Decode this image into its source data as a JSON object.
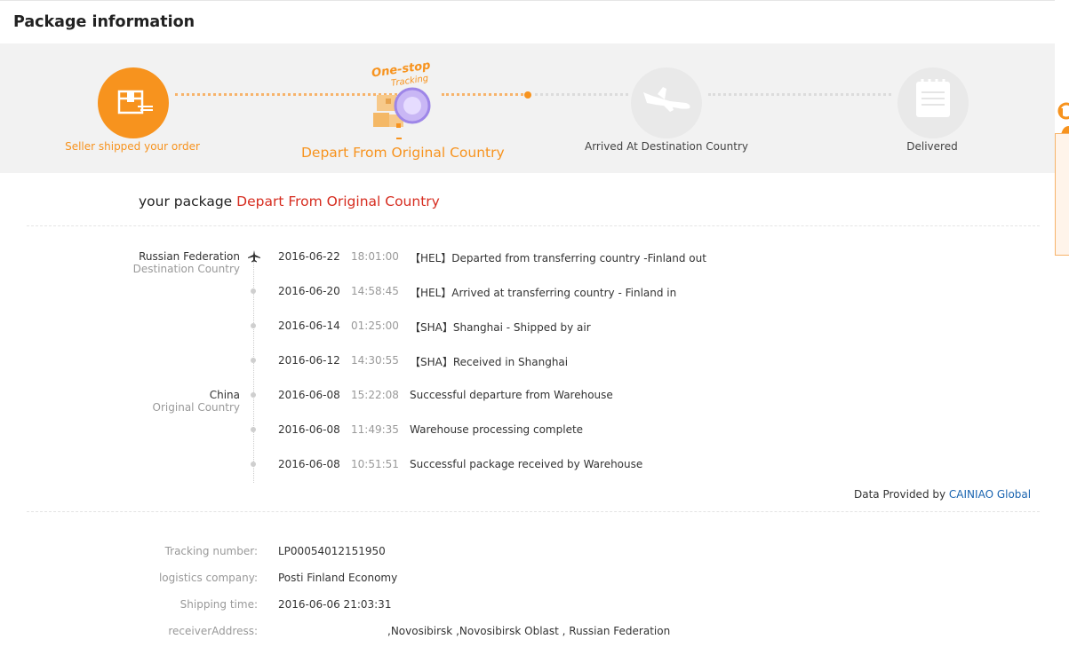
{
  "header": {
    "title": "Package information"
  },
  "steps": [
    {
      "label": "Seller shipped your order",
      "status": "done",
      "icon": "package-box-icon"
    },
    {
      "label": "Depart From Original Country",
      "status": "current",
      "icon": "one-stop-tracking-icon",
      "badge_line1": "One-stop",
      "badge_line2": "Tracking"
    },
    {
      "label": "Arrived At Destination Country",
      "status": "pending",
      "icon": "airplane-icon"
    },
    {
      "label": "Delivered",
      "status": "pending",
      "icon": "notepad-icon"
    }
  ],
  "summary": {
    "prefix": "your package",
    "status": "Depart From Original Country"
  },
  "locations": {
    "destination": {
      "name": "Russian Federation",
      "label": "Destination Country"
    },
    "origin": {
      "name": "China",
      "label": "Original Country"
    }
  },
  "events": [
    {
      "date": "2016-06-22",
      "time": "18:01:00",
      "desc": "【HEL】Departed from transferring country -Finland out"
    },
    {
      "date": "2016-06-20",
      "time": "14:58:45",
      "desc": "【HEL】Arrived at transferring country - Finland in"
    },
    {
      "date": "2016-06-14",
      "time": "01:25:00",
      "desc": "【SHA】Shanghai - Shipped by air"
    },
    {
      "date": "2016-06-12",
      "time": "14:30:55",
      "desc": "【SHA】Received in Shanghai"
    },
    {
      "date": "2016-06-08",
      "time": "15:22:08",
      "desc": "Successful departure from Warehouse"
    },
    {
      "date": "2016-06-08",
      "time": "11:49:35",
      "desc": "Warehouse processing complete"
    },
    {
      "date": "2016-06-08",
      "time": "10:51:51",
      "desc": "Successful package received by Warehouse"
    }
  ],
  "provider": {
    "prefix": "Data Provided by",
    "name": "CAINIAO Global"
  },
  "details": {
    "tracking_label": "Tracking number:",
    "tracking_value": "LP00054012151950",
    "company_label": "logistics company:",
    "company_value": "Posti Finland Economy",
    "shipping_label": "Shipping time:",
    "shipping_value": "2016-06-06 21:03:31",
    "address_label": "receiverAddress:",
    "address_value": ",Novosibirsk ,Novosibirsk Oblast , Russian Federation"
  },
  "colors": {
    "accent": "#f7931e",
    "status_red": "#d62c1f",
    "link": "#1a64b0"
  }
}
